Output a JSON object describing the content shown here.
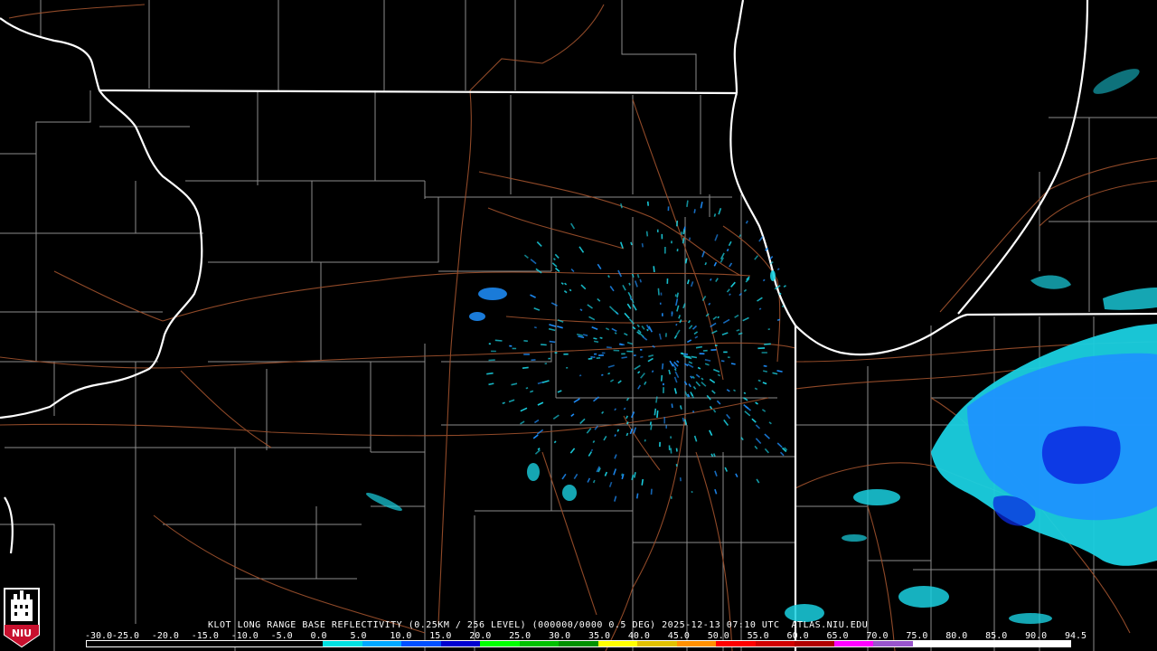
{
  "product_title": "KLOT LONG RANGE BASE REFLECTIVITY (0.25KM / 256 LEVEL) (000000/0000 0.5 DEG) 2025-12-13 07:10 UTC  ATLAS.NIU.EDU",
  "colorbar": {
    "labels": [
      "-30.0",
      "-25.0",
      "-20.0",
      "-15.0",
      "-10.0",
      "-5.0",
      "0.0",
      "5.0",
      "10.0",
      "15.0",
      "20.0",
      "25.0",
      "30.0",
      "35.0",
      "40.0",
      "45.0",
      "50.0",
      "55.0",
      "60.0",
      "65.0",
      "70.0",
      "75.0",
      "80.0",
      "85.0",
      "90.0",
      "94.5"
    ],
    "colors": [
      "#000000",
      "#000000",
      "#000000",
      "#000000",
      "#000000",
      "#000000",
      "#00e0e0",
      "#00a8ff",
      "#0050ff",
      "#0000d0",
      "#00ff00",
      "#00c000",
      "#009000",
      "#ffff00",
      "#e0c000",
      "#ff9000",
      "#ff0000",
      "#d00000",
      "#b00000",
      "#ff00ff",
      "#9955cc",
      "#ffffff",
      "#ffffff",
      "#ffffff",
      "#ffffff"
    ]
  },
  "logo": {
    "label": "NIU"
  },
  "colors": {
    "state_border": "#ffffff",
    "county_border": "#8c8c8c",
    "road": "#a0522d",
    "echo_light": "#1ad0e0",
    "echo_mid": "#1e90ff",
    "echo_heavy": "#0a2ae0"
  }
}
